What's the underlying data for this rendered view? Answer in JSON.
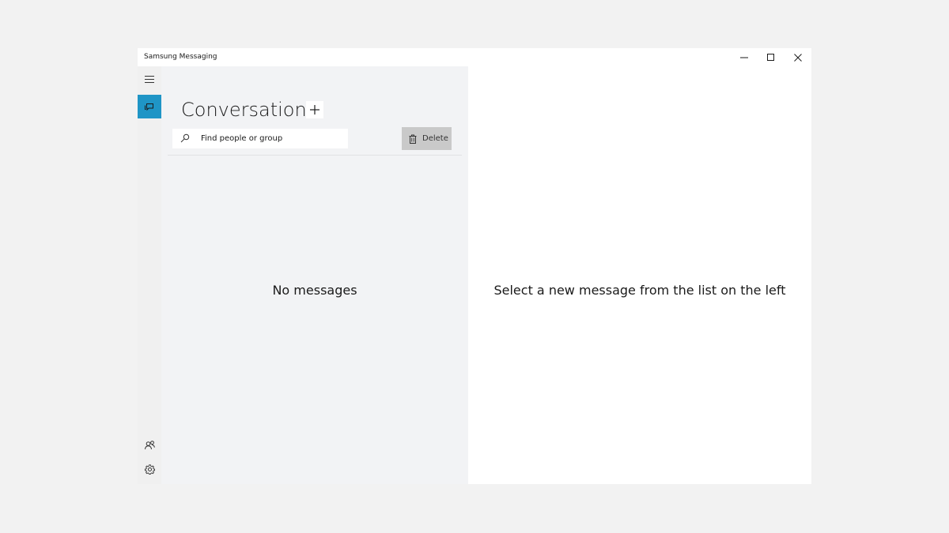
{
  "window": {
    "title": "Samsung Messaging"
  },
  "navrail": {
    "items": [
      {
        "icon": "hamburger-menu-icon"
      },
      {
        "icon": "conversations-icon",
        "active": true
      },
      {
        "icon": "contacts-icon"
      },
      {
        "icon": "gear-icon"
      }
    ],
    "active_color": "#1f95c6"
  },
  "conversations": {
    "heading": "Conversations",
    "add_icon": "plus-icon",
    "search": {
      "placeholder": "Find people or group",
      "value": ""
    },
    "delete_label": "Delete",
    "empty_text": "No messages"
  },
  "detail": {
    "hint": "Select a new message from the list on the left"
  }
}
